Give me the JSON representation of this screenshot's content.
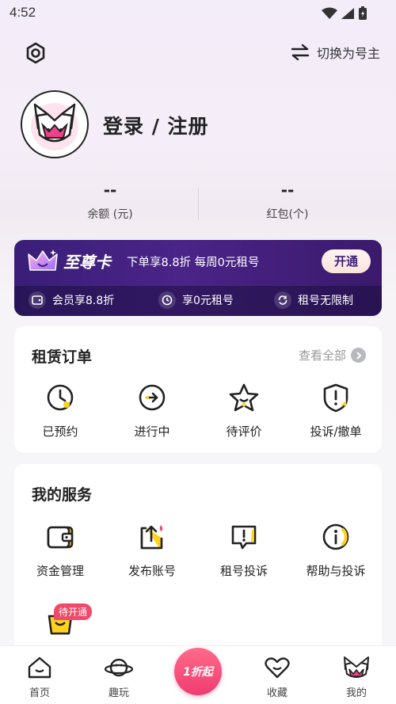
{
  "status_bar": {
    "time": "4:52"
  },
  "header": {
    "switch_label": "切换为号主"
  },
  "profile": {
    "login_label": "登录 / 注册"
  },
  "stats": [
    {
      "value": "--",
      "label": "余额 (元)"
    },
    {
      "value": "--",
      "label": "红包(个)"
    }
  ],
  "vip": {
    "title": "至尊卡",
    "desc": "下单享8.8折 每周0元租号",
    "open_label": "开通",
    "perks": [
      "会员享8.8折",
      "享0元租号",
      "租号无限制"
    ]
  },
  "orders": {
    "title": "租赁订单",
    "view_all": "查看全部",
    "items": [
      {
        "label": "已预约",
        "icon": "clock-icon"
      },
      {
        "label": "进行中",
        "icon": "arrow-circle-icon"
      },
      {
        "label": "待评价",
        "icon": "star-icon"
      },
      {
        "label": "投诉/撤单",
        "icon": "shield-alert-icon"
      }
    ]
  },
  "services": {
    "title": "我的服务",
    "items": [
      {
        "label": "资金管理",
        "icon": "wallet-icon"
      },
      {
        "label": "发布账号",
        "icon": "upload-icon"
      },
      {
        "label": "租号投诉",
        "icon": "complaint-icon"
      },
      {
        "label": "帮助与投诉",
        "icon": "info-icon"
      }
    ],
    "extra_badge": "待开通"
  },
  "nav": {
    "items": [
      {
        "label": "首页",
        "icon": "home-icon"
      },
      {
        "label": "趣玩",
        "icon": "planet-icon"
      },
      {
        "label": "",
        "icon": "discount-icon"
      },
      {
        "label": "收藏",
        "icon": "heart-icon"
      },
      {
        "label": "我的",
        "icon": "profile-icon"
      }
    ],
    "center_label": "1折起"
  },
  "colors": {
    "accent": "#ffd21e",
    "vip_bg": "#3a1e78",
    "badge": "#f04a6a"
  }
}
